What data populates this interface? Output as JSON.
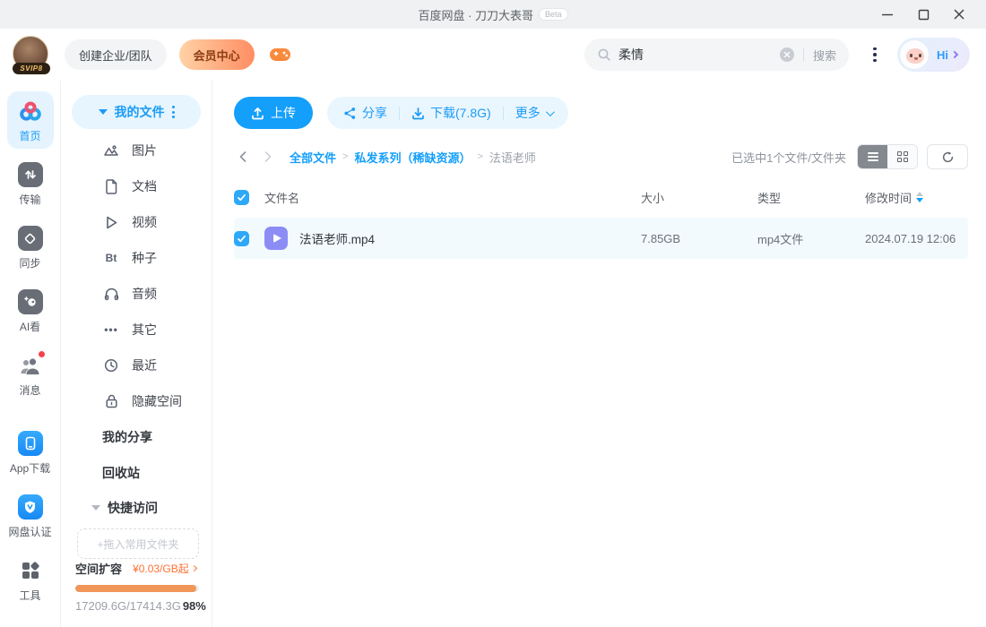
{
  "titlebar": {
    "title": "百度网盘 · 刀刀大表哥",
    "beta": "Beta"
  },
  "header": {
    "vip_badge": "SVIP8",
    "create_team": "创建企业/团队",
    "vip_center": "会员中心",
    "search": {
      "value": "柔情",
      "submit": "搜索"
    },
    "greeting": "Hi"
  },
  "rail": {
    "home": "首页",
    "transfer": "传输",
    "sync": "同步",
    "ai": "AI看",
    "messages": "消息",
    "app_download": "App下载",
    "verify": "网盘认证",
    "tools": "工具"
  },
  "sidebar": {
    "my_files": "我的文件",
    "categories": [
      {
        "label": "图片"
      },
      {
        "label": "文档"
      },
      {
        "label": "视频"
      },
      {
        "label": "种子"
      },
      {
        "label": "音频"
      },
      {
        "label": "其它"
      },
      {
        "label": "最近"
      },
      {
        "label": "隐藏空间"
      }
    ],
    "my_share": "我的分享",
    "recycle_bin": "回收站",
    "quick_access": "快捷访问",
    "drop_hint": "+拖入常用文件夹",
    "expand_label": "空间扩容",
    "expand_price": "¥0.03/GB起",
    "storage_text": "17209.6G/17414.3G",
    "storage_percent": "98%"
  },
  "main": {
    "toolbar": {
      "upload": "上传",
      "share": "分享",
      "download": "下载(7.8G)",
      "more": "更多"
    },
    "breadcrumb": {
      "root": "全部文件",
      "folder": "私发系列（稀缺资源）",
      "current": "法语老师",
      "sep": ">"
    },
    "selection_info": "已选中1个文件/文件夹",
    "table": {
      "col_name": "文件名",
      "col_size": "大小",
      "col_type": "类型",
      "col_modified": "修改时间",
      "rows": [
        {
          "name": "法语老师.mp4",
          "size": "7.85GB",
          "type": "mp4文件",
          "modified": "2024.07.19 12:06"
        }
      ]
    }
  },
  "icons": {
    "bt": "Bt",
    "ellipsis": "•••"
  },
  "colors": {
    "accent_blue": "#149ffb",
    "accent_orange": "#ff7033",
    "progress_fill": "#ef9658",
    "selected_row_bg": "#f2fafe",
    "vip_gradient": "#ffd2a6 → #ff8d62"
  }
}
